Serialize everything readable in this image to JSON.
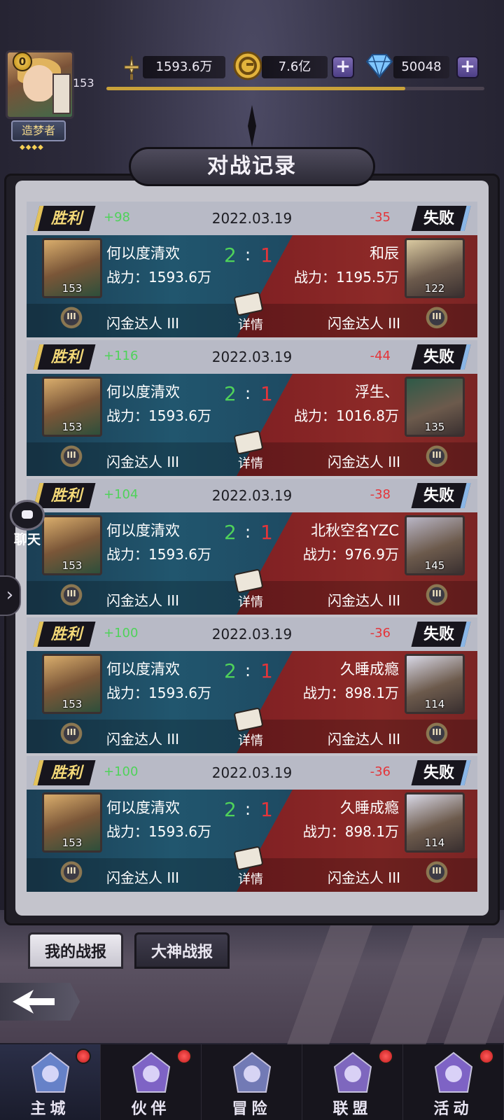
{
  "player": {
    "vip_level": "0",
    "level": "153",
    "title": "造梦者",
    "level_progress": 0.79
  },
  "resources": {
    "power": "1593.6万",
    "gold": "7.6亿",
    "diamond": "50048"
  },
  "panel": {
    "title": "对战记录"
  },
  "records": [
    {
      "result_left": "胜利",
      "gain": "+98",
      "date": "2022.03.19",
      "loss": "-35",
      "result_right": "失败",
      "player_name": "何以度清欢",
      "player_power": "战力：1593.6万",
      "player_level": "153",
      "player_rank": "闪金达人 III",
      "score_left": "2",
      "score_sep": ":",
      "score_right": "1",
      "opponent_name": "和辰",
      "opponent_power": "战力：1195.5万",
      "opponent_level": "122",
      "opponent_rank": "闪金达人 III",
      "detail_label": "详情"
    },
    {
      "result_left": "胜利",
      "gain": "+116",
      "date": "2022.03.19",
      "loss": "-44",
      "result_right": "失败",
      "player_name": "何以度清欢",
      "player_power": "战力：1593.6万",
      "player_level": "153",
      "player_rank": "闪金达人 III",
      "score_left": "2",
      "score_sep": ":",
      "score_right": "1",
      "opponent_name": "浮生、",
      "opponent_power": "战力：1016.8万",
      "opponent_level": "135",
      "opponent_rank": "闪金达人 III",
      "detail_label": "详情"
    },
    {
      "result_left": "胜利",
      "gain": "+104",
      "date": "2022.03.19",
      "loss": "-38",
      "result_right": "失败",
      "player_name": "何以度清欢",
      "player_power": "战力：1593.6万",
      "player_level": "153",
      "player_rank": "闪金达人 III",
      "score_left": "2",
      "score_sep": ":",
      "score_right": "1",
      "opponent_name": "北秋空名YZC",
      "opponent_power": "战力：976.9万",
      "opponent_level": "145",
      "opponent_rank": "闪金达人 III",
      "detail_label": "详情"
    },
    {
      "result_left": "胜利",
      "gain": "+100",
      "date": "2022.03.19",
      "loss": "-36",
      "result_right": "失败",
      "player_name": "何以度清欢",
      "player_power": "战力：1593.6万",
      "player_level": "153",
      "player_rank": "闪金达人 III",
      "score_left": "2",
      "score_sep": ":",
      "score_right": "1",
      "opponent_name": "久睡成瘾",
      "opponent_power": "战力：898.1万",
      "opponent_level": "114",
      "opponent_rank": "闪金达人 III",
      "detail_label": "详情"
    },
    {
      "result_left": "胜利",
      "gain": "+100",
      "date": "2022.03.19",
      "loss": "-36",
      "result_right": "失败",
      "player_name": "何以度清欢",
      "player_power": "战力：1593.6万",
      "player_level": "153",
      "player_rank": "闪金达人 III",
      "score_left": "2",
      "score_sep": ":",
      "score_right": "1",
      "opponent_name": "久睡成瘾",
      "opponent_power": "战力：898.1万",
      "opponent_level": "114",
      "opponent_rank": "闪金达人 III",
      "detail_label": "详情"
    }
  ],
  "tabs": {
    "my_reports": "我的战报",
    "master_reports": "大神战报"
  },
  "side": {
    "chat_label": "聊天",
    "expand_icon": "chevron-right-icon",
    "back_icon": "back-arrow-icon"
  },
  "nav": [
    {
      "label": "主城",
      "icon": "castle-icon",
      "badge": true
    },
    {
      "label": "伙伴",
      "icon": "witch-hat-icon",
      "badge": true
    },
    {
      "label": "冒险",
      "icon": "compass-icon",
      "badge": false
    },
    {
      "label": "联盟",
      "icon": "shield-icon",
      "badge": true
    },
    {
      "label": "活动",
      "icon": "cards-icon",
      "badge": true
    }
  ],
  "colors": {
    "win_green": "#4fd25a",
    "loss_red": "#e4353a",
    "gold_accent": "#f4d978",
    "blue_side": "#21566e",
    "red_side": "#8d2a28"
  }
}
